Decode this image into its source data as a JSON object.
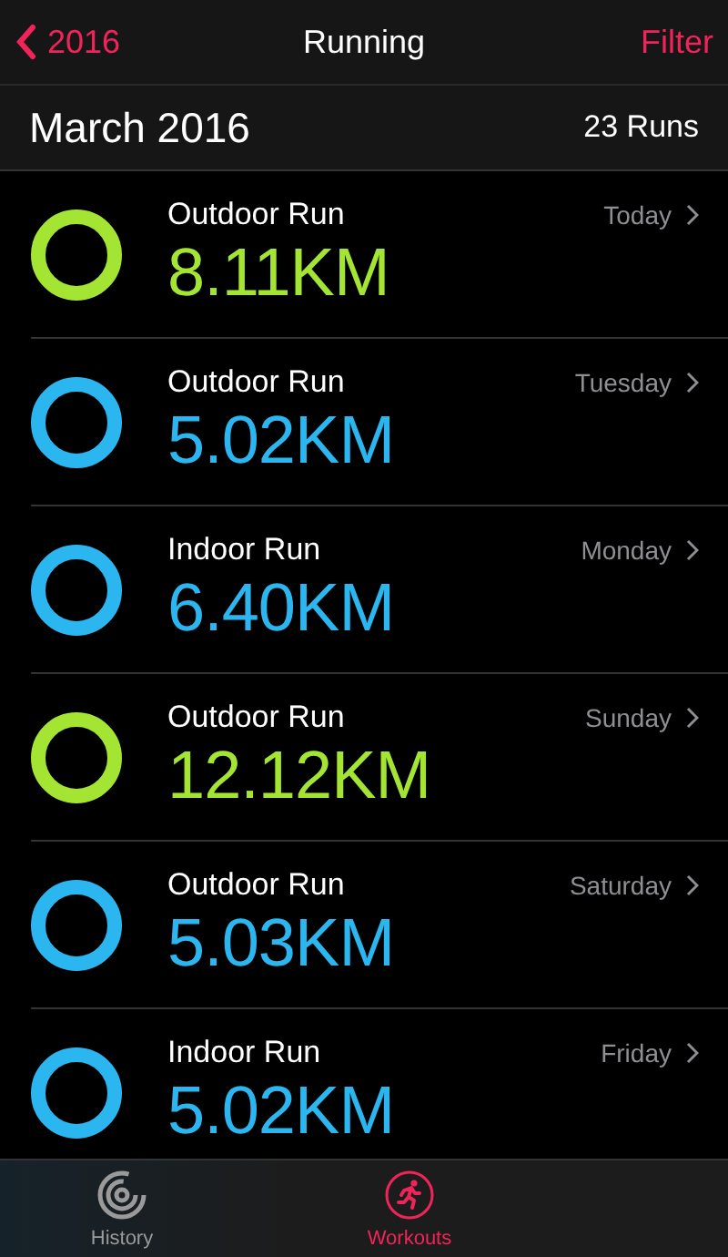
{
  "nav": {
    "back": "2016",
    "title": "Running",
    "action": "Filter"
  },
  "section": {
    "title": "March 2016",
    "count": "23 Runs"
  },
  "workouts": [
    {
      "type": "Outdoor Run",
      "distance": "8.11KM",
      "day": "Today",
      "color": "#a4e534"
    },
    {
      "type": "Outdoor Run",
      "distance": "5.02KM",
      "day": "Tuesday",
      "color": "#2bb6f0"
    },
    {
      "type": "Indoor Run",
      "distance": "6.40KM",
      "day": "Monday",
      "color": "#2bb6f0"
    },
    {
      "type": "Outdoor Run",
      "distance": "12.12KM",
      "day": "Sunday",
      "color": "#a4e534"
    },
    {
      "type": "Outdoor Run",
      "distance": "5.03KM",
      "day": "Saturday",
      "color": "#2bb6f0"
    },
    {
      "type": "Indoor Run",
      "distance": "5.02KM",
      "day": "Friday",
      "color": "#2bb6f0"
    }
  ],
  "tabs": [
    {
      "label": "History",
      "kind": "history",
      "selected": false
    },
    {
      "label": "Workouts",
      "kind": "workouts",
      "selected": true
    }
  ]
}
